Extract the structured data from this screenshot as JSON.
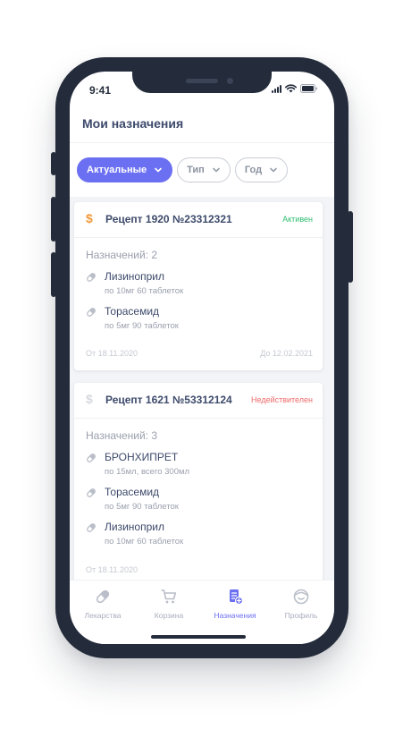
{
  "status_bar": {
    "time": "9:41"
  },
  "header": {
    "title": "Мои назначения"
  },
  "filters": [
    {
      "label": "Актуальные",
      "active": true
    },
    {
      "label": "Тип",
      "active": false
    },
    {
      "label": "Год",
      "active": false
    }
  ],
  "prescriptions": [
    {
      "title": "Рецепт 1920 №23312321",
      "status": "Активен",
      "status_color": "#2dbd6e",
      "currency_color": "#f29a38",
      "count_label": "Назначений: 2",
      "items": [
        {
          "name": "Лизиноприл",
          "dose": "по 10мг 60 таблеток"
        },
        {
          "name": "Торасемид",
          "dose": "по 5мг 90 таблеток"
        }
      ],
      "date_from": "От 18.11.2020",
      "date_to": "До 12.02.2021"
    },
    {
      "title": "Рецепт 1621 №53312124",
      "status": "Недействителен",
      "status_color": "#ef6a6a",
      "currency_color": "#d5d8de",
      "count_label": "Назначений: 3",
      "items": [
        {
          "name": "БРОНХИПРЕТ",
          "dose": "по 15мл, всего 300мл"
        },
        {
          "name": "Торасемид",
          "dose": "по 5мг 90 таблеток"
        },
        {
          "name": "Лизиноприл",
          "dose": "по 10мг 60 таблеток"
        }
      ],
      "date_from": "От 18.11.2020"
    }
  ],
  "tabbar": [
    {
      "label": "Лекарства",
      "icon": "pill-icon",
      "active": false
    },
    {
      "label": "Корзина",
      "icon": "cart-icon",
      "active": false
    },
    {
      "label": "Назначения",
      "icon": "prescription-icon",
      "active": true
    },
    {
      "label": "Профиль",
      "icon": "profile-icon",
      "active": false
    }
  ],
  "colors": {
    "accent": "#6b6ff2",
    "text": "#3d4a6b",
    "muted": "#9aa0ad"
  }
}
